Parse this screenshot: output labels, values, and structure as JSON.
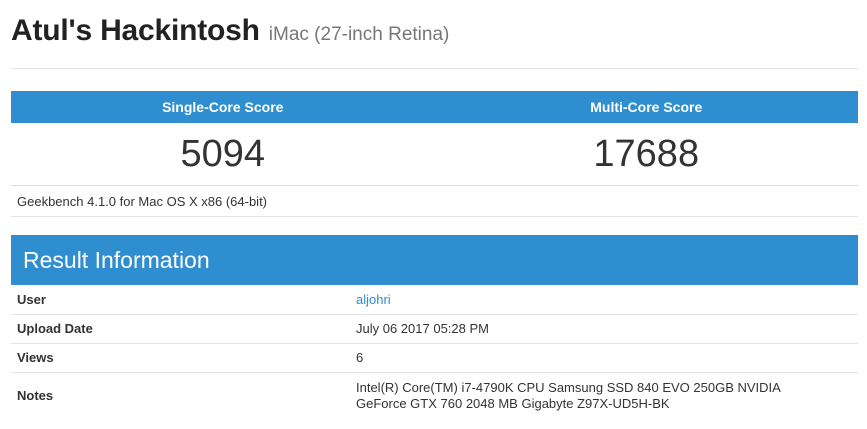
{
  "header": {
    "title": "Atul's Hackintosh",
    "subtitle": "iMac (27-inch Retina)"
  },
  "scores": {
    "single_core_label": "Single-Core Score",
    "multi_core_label": "Multi-Core Score",
    "single_core_value": "5094",
    "multi_core_value": "17688"
  },
  "platform": "Geekbench 4.1.0 for Mac OS X x86 (64-bit)",
  "result_information": {
    "heading": "Result Information",
    "rows": [
      {
        "label": "User",
        "value": "aljohri"
      },
      {
        "label": "Upload Date",
        "value": "July 06 2017 05:28 PM"
      },
      {
        "label": "Views",
        "value": "6"
      },
      {
        "label": "Notes",
        "value": "Intel(R) Core(TM) i7-4790K CPU Samsung SSD 840 EVO 250GB NVIDIA GeForce GTX 760 2048 MB Gigabyte Z97X-UD5H-BK"
      }
    ]
  },
  "colors": {
    "accent": "#2e8ed0",
    "text": "#333333",
    "muted": "#777777"
  }
}
